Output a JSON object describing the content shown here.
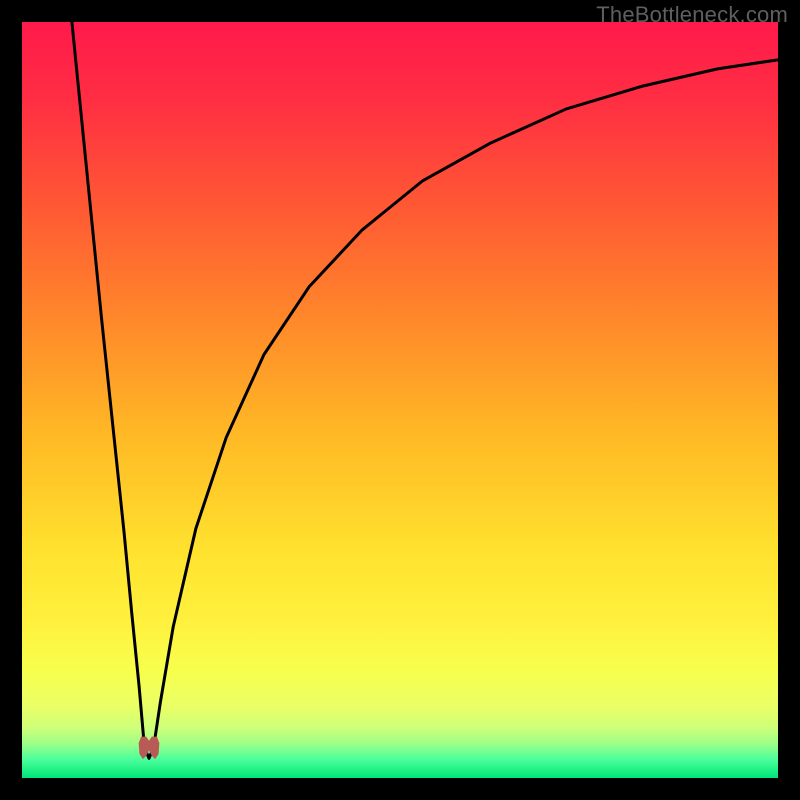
{
  "watermark": "TheBottleneck.com",
  "colors": {
    "frame": "#000000",
    "curve": "#000000",
    "marker": "#b85a56",
    "gradient_stops": [
      {
        "offset": 0.0,
        "color": "#ff1a4b"
      },
      {
        "offset": 0.1,
        "color": "#ff2d43"
      },
      {
        "offset": 0.25,
        "color": "#ff5a33"
      },
      {
        "offset": 0.4,
        "color": "#ff8a2a"
      },
      {
        "offset": 0.55,
        "color": "#ffba25"
      },
      {
        "offset": 0.7,
        "color": "#ffe22e"
      },
      {
        "offset": 0.8,
        "color": "#fff23f"
      },
      {
        "offset": 0.86,
        "color": "#f7ff4d"
      },
      {
        "offset": 0.905,
        "color": "#eaff66"
      },
      {
        "offset": 0.935,
        "color": "#ccff7a"
      },
      {
        "offset": 0.955,
        "color": "#9cff88"
      },
      {
        "offset": 0.975,
        "color": "#4dff9c"
      },
      {
        "offset": 1.0,
        "color": "#00e676"
      }
    ]
  },
  "chart_data": {
    "type": "line",
    "title": "",
    "xlabel": "",
    "ylabel": "",
    "xlim": [
      0,
      100
    ],
    "ylim": [
      0,
      100
    ],
    "grid": false,
    "optimum_x": 16.8,
    "curve": [
      {
        "x": 6.6,
        "y": 100.0
      },
      {
        "x": 7.5,
        "y": 91.0
      },
      {
        "x": 8.5,
        "y": 81.0
      },
      {
        "x": 9.5,
        "y": 71.0
      },
      {
        "x": 10.5,
        "y": 61.0
      },
      {
        "x": 11.5,
        "y": 51.5
      },
      {
        "x": 12.5,
        "y": 42.0
      },
      {
        "x": 13.5,
        "y": 32.5
      },
      {
        "x": 14.5,
        "y": 22.0
      },
      {
        "x": 15.5,
        "y": 12.0
      },
      {
        "x": 16.2,
        "y": 4.0
      },
      {
        "x": 16.8,
        "y": 2.6
      },
      {
        "x": 17.4,
        "y": 4.0
      },
      {
        "x": 18.3,
        "y": 10.0
      },
      {
        "x": 20.0,
        "y": 20.0
      },
      {
        "x": 23.0,
        "y": 33.0
      },
      {
        "x": 27.0,
        "y": 45.0
      },
      {
        "x": 32.0,
        "y": 56.0
      },
      {
        "x": 38.0,
        "y": 65.0
      },
      {
        "x": 45.0,
        "y": 72.5
      },
      {
        "x": 53.0,
        "y": 79.0
      },
      {
        "x": 62.0,
        "y": 84.0
      },
      {
        "x": 72.0,
        "y": 88.5
      },
      {
        "x": 82.0,
        "y": 91.5
      },
      {
        "x": 92.0,
        "y": 93.8
      },
      {
        "x": 100.0,
        "y": 95.0
      }
    ],
    "marker_shape": [
      {
        "x": 15.5,
        "y": 4.6
      },
      {
        "x": 15.6,
        "y": 3.2
      },
      {
        "x": 16.0,
        "y": 2.6
      },
      {
        "x": 16.4,
        "y": 3.0
      },
      {
        "x": 16.8,
        "y": 3.8
      },
      {
        "x": 17.2,
        "y": 3.0
      },
      {
        "x": 17.6,
        "y": 2.6
      },
      {
        "x": 18.0,
        "y": 3.2
      },
      {
        "x": 18.1,
        "y": 4.6
      },
      {
        "x": 17.8,
        "y": 5.4
      },
      {
        "x": 17.2,
        "y": 5.4
      },
      {
        "x": 16.8,
        "y": 4.8
      },
      {
        "x": 16.4,
        "y": 5.4
      },
      {
        "x": 15.8,
        "y": 5.4
      }
    ]
  }
}
